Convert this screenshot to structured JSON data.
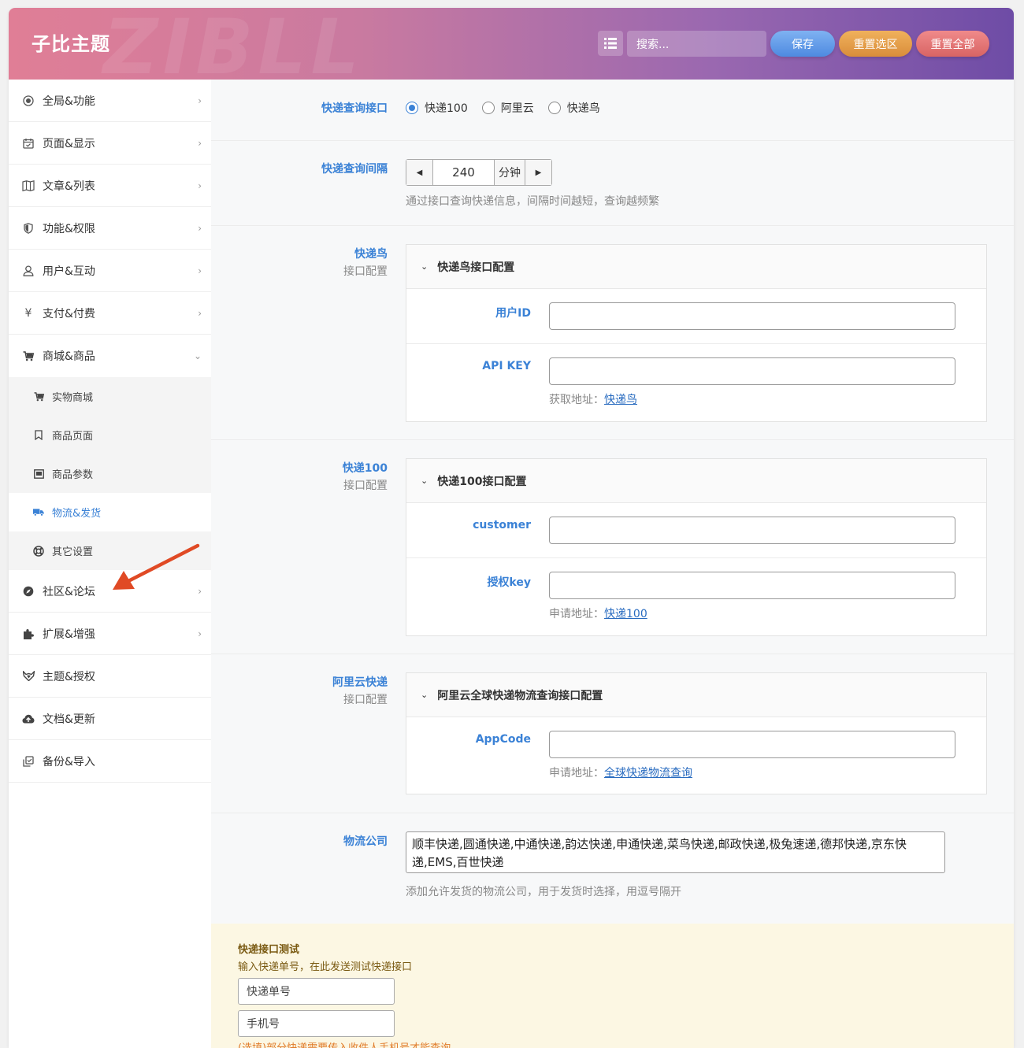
{
  "header": {
    "brand": "子比主题",
    "watermark": "ZIBLL",
    "search_placeholder": "搜索...",
    "save": "保存",
    "reset_section": "重置选区",
    "reset_all": "重置全部"
  },
  "sidebar": {
    "items": [
      {
        "label": "全局&功能",
        "icon": "target-icon"
      },
      {
        "label": "页面&显示",
        "icon": "calendar-icon"
      },
      {
        "label": "文章&列表",
        "icon": "map-icon"
      },
      {
        "label": "功能&权限",
        "icon": "shield-icon"
      },
      {
        "label": "用户&互动",
        "icon": "user-icon"
      },
      {
        "label": "支付&付费",
        "icon": "yen-icon"
      },
      {
        "label": "商城&商品",
        "icon": "cart-icon"
      }
    ],
    "sub_items": [
      {
        "label": "实物商城",
        "icon": "cart-icon"
      },
      {
        "label": "商品页面",
        "icon": "bookmark-icon"
      },
      {
        "label": "商品参数",
        "icon": "panel-icon"
      },
      {
        "label": "物流&发货",
        "icon": "truck-icon"
      },
      {
        "label": "其它设置",
        "icon": "lifebuoy-icon"
      }
    ],
    "items_after": [
      {
        "label": "社区&论坛",
        "icon": "compass-icon"
      },
      {
        "label": "扩展&增强",
        "icon": "puzzle-icon"
      },
      {
        "label": "主题&授权",
        "icon": "fox-icon"
      },
      {
        "label": "文档&更新",
        "icon": "cloud-icon"
      },
      {
        "label": "备份&导入",
        "icon": "copy-icon"
      }
    ]
  },
  "content": {
    "api": {
      "label": "快递查询接口",
      "options": [
        "快递100",
        "阿里云",
        "快递鸟"
      ],
      "selected": "快递100"
    },
    "interval": {
      "label": "快递查询间隔",
      "value": "240",
      "unit": "分钟",
      "help": "通过接口查询快递信息，间隔时间越短，查询越频繁"
    },
    "kdniao": {
      "label": "快递鸟",
      "sublabel": "接口配置",
      "box_title": "快递鸟接口配置",
      "field1": "用户ID",
      "field2": "API KEY",
      "help_prefix": "获取地址：",
      "help_link": "快递鸟"
    },
    "kd100": {
      "label": "快递100",
      "sublabel": "接口配置",
      "box_title": "快递100接口配置",
      "field1": "customer",
      "field2": "授权key",
      "help_prefix": "申请地址：",
      "help_link": "快递100"
    },
    "aliyun": {
      "label": "阿里云快递",
      "sublabel": "接口配置",
      "box_title": "阿里云全球快递物流查询接口配置",
      "field1": "AppCode",
      "help_prefix": "申请地址：",
      "help_link": "全球快递物流查询"
    },
    "companies": {
      "label": "物流公司",
      "value": "顺丰快递,圆通快递,中通快递,韵达快递,申通快递,菜鸟快递,邮政快递,极兔速递,德邦快递,京东快递,EMS,百世快递",
      "help": "添加允许发货的物流公司，用于发货时选择，用逗号隔开"
    },
    "test": {
      "title": "快递接口测试",
      "desc": "输入快递单号，在此发送测试快递接口",
      "tracking_placeholder": "快递单号",
      "phone_placeholder": "手机号",
      "note": "(选填)部分快递需要传入收件人手机号才能查询"
    }
  }
}
